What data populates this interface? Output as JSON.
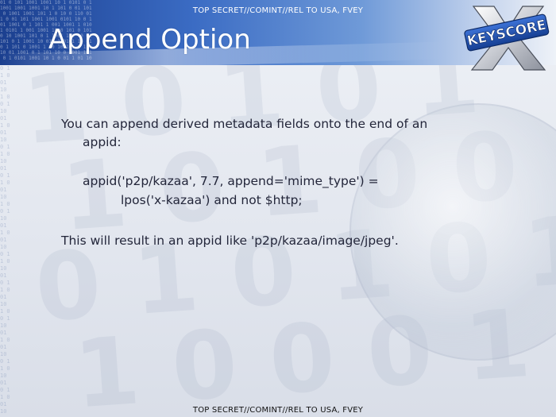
{
  "slide": {
    "classification_top": "TOP SECRET//COMINT//REL TO USA, FVEY",
    "classification_bottom": "TOP SECRET//COMINT//REL TO USA, FVEY",
    "title": "Append Option",
    "logo_text": "KEYSCORE",
    "body": {
      "intro_line1": "You can append derived metadata fields onto the end of an",
      "intro_line2": "appid:",
      "code_line1": "appid('p2p/kazaa', 7.7, append='mime_type') =",
      "code_line2": "lpos('x-kazaa') and not $http;",
      "result": "This will result in an appid like 'p2p/kazaa/image/jpeg'."
    }
  },
  "colors": {
    "header_dark": "#1b3f8f",
    "header_mid": "#3b6cc4",
    "text": "#23263a",
    "logo_blue": "#1f4fb0"
  }
}
